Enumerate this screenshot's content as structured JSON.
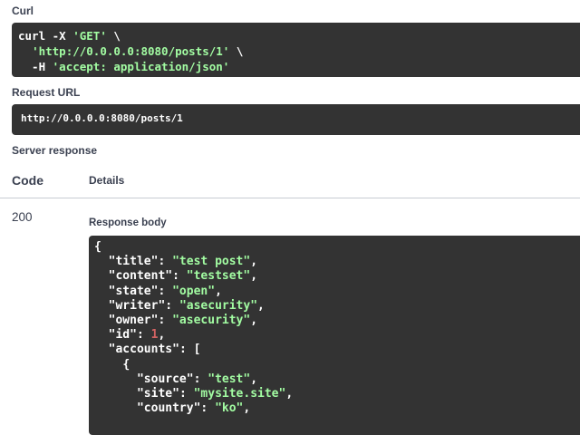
{
  "curl": {
    "label": "Curl",
    "line1_cmd": "curl -X ",
    "line1_method": "'GET'",
    "line1_tail": " \\",
    "line2_indent": "  ",
    "line2_url": "'http://0.0.0.0:8080/posts/1'",
    "line2_tail": " \\",
    "line3_indent": "  -H ",
    "line3_header": "'accept: application/json'"
  },
  "request_url": {
    "label": "Request URL",
    "value": "http://0.0.0.0:8080/posts/1"
  },
  "server_response": {
    "label": "Server response",
    "col_code": "Code",
    "col_details": "Details",
    "code": "200",
    "body_label": "Response body",
    "body": {
      "open": "{",
      "title_key": "\"title\"",
      "title_val": "\"test post\"",
      "content_key": "\"content\"",
      "content_val": "\"testset\"",
      "state_key": "\"state\"",
      "state_val": "\"open\"",
      "writer_key": "\"writer\"",
      "writer_val": "\"asecurity\"",
      "owner_key": "\"owner\"",
      "owner_val": "\"asecurity\"",
      "id_key": "\"id\"",
      "id_val": "1",
      "accounts_key": "\"accounts\"",
      "accounts_open": "[",
      "obj_open": "{",
      "source_key": "\"source\"",
      "source_val": "\"test\"",
      "site_key": "\"site\"",
      "site_val": "\"mysite.site\"",
      "country_key": "\"country\"",
      "country_val": "\"ko\""
    }
  },
  "colors": {
    "code_bg": "#333333",
    "string": "#a2fca2",
    "number": "#d36363",
    "text": "#3b4151"
  }
}
